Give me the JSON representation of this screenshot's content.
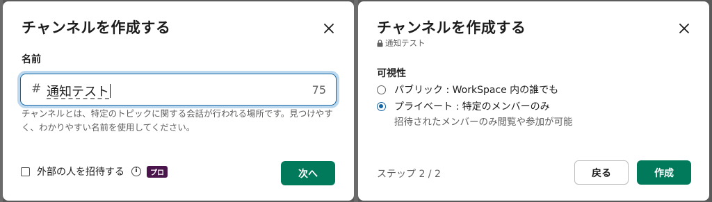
{
  "step1": {
    "title": "チャンネルを作成する",
    "field_label": "名前",
    "hash_symbol": "#",
    "name_value": "通知テスト",
    "name_counter": "75",
    "help_text": "チャンネルとは、特定のトピックに関する会話が行われる場所です。見つけやすく、わかりやすい名前を使用してください。",
    "invite_label": "外部の人を招待する",
    "pro_badge": "プロ",
    "next_button": "次へ"
  },
  "step2": {
    "title": "チャンネルを作成する",
    "channel_name": "通知テスト",
    "visibility_label": "可視性",
    "options": [
      {
        "label": "パブリック : WorkSpace 内の誰でも",
        "selected": false
      },
      {
        "label": "プライベート : 特定のメンバーのみ",
        "selected": true
      }
    ],
    "private_description": "招待されたメンバーのみ閲覧や参加が可能",
    "step_text": "ステップ 2 / 2",
    "back_button": "戻る",
    "create_button": "作成"
  },
  "colors": {
    "primary": "#007a5a",
    "focus": "#1264a3",
    "pro_badge": "#4a154b"
  },
  "icons": {
    "close": "close-icon",
    "info": "info-icon",
    "lock": "lock-icon"
  }
}
